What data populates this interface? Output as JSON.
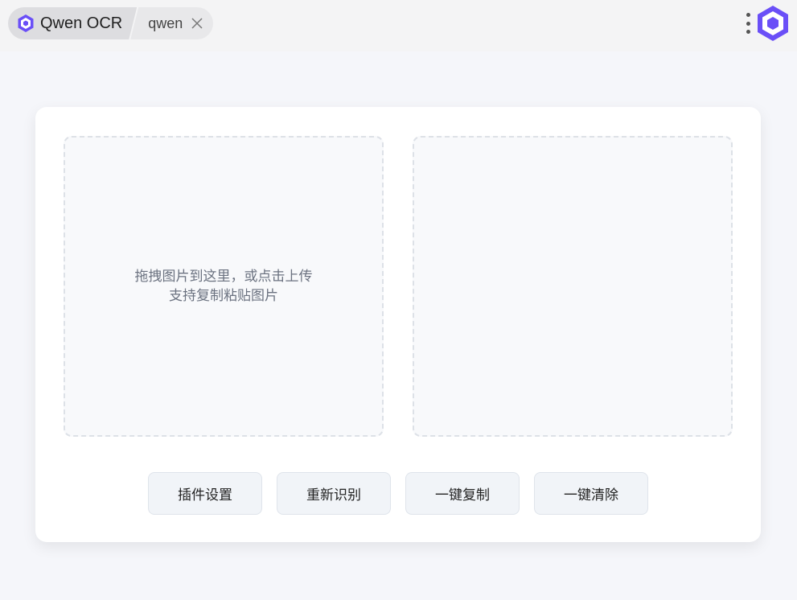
{
  "browser": {
    "app_tab": {
      "label": "Qwen OCR",
      "icon": "qwen-logo-icon"
    },
    "site_tab": {
      "label": "qwen",
      "close_icon": "close-icon"
    },
    "menu_icon": "vertical-dots-icon",
    "logo_icon": "qwen-logo-icon"
  },
  "main": {
    "upload_hint_line1": "拖拽图片到这里，或点击上传",
    "upload_hint_line2": "支持复制粘贴图片",
    "result_text": ""
  },
  "buttons": {
    "settings": "插件设置",
    "recognize": "重新识别",
    "copy": "一键复制",
    "clear": "一键清除"
  },
  "colors": {
    "logo_purple": "#6a4ff7",
    "page_bg": "#f5f6fa",
    "card_bg": "#ffffff"
  }
}
